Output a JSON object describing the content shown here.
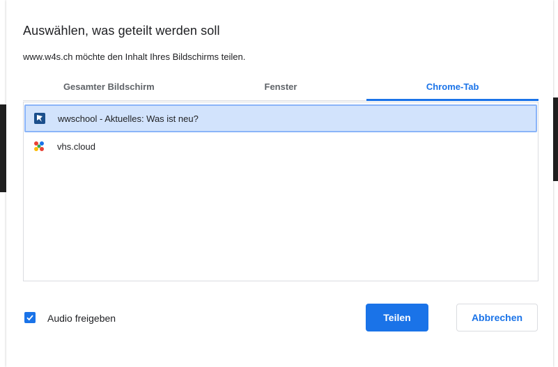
{
  "dialog": {
    "title": "Auswählen, was geteilt werden soll",
    "subtitle": "www.w4s.ch möchte den Inhalt Ihres Bildschirms teilen."
  },
  "tabs": [
    {
      "label": "Gesamter Bildschirm",
      "active": false
    },
    {
      "label": "Fenster",
      "active": false
    },
    {
      "label": "Chrome-Tab",
      "active": true
    }
  ],
  "items": [
    {
      "label": "wwschool - Aktuelles: Was ist neu?",
      "icon": "wwschool-favicon",
      "selected": true
    },
    {
      "label": "vhs.cloud",
      "icon": "vhs-cloud-favicon",
      "selected": false
    }
  ],
  "audio": {
    "label": "Audio freigeben",
    "checked": true
  },
  "buttons": {
    "share": "Teilen",
    "cancel": "Abbrechen"
  },
  "colors": {
    "accent": "#1a73e8",
    "selected_bg": "#d2e3fc"
  }
}
